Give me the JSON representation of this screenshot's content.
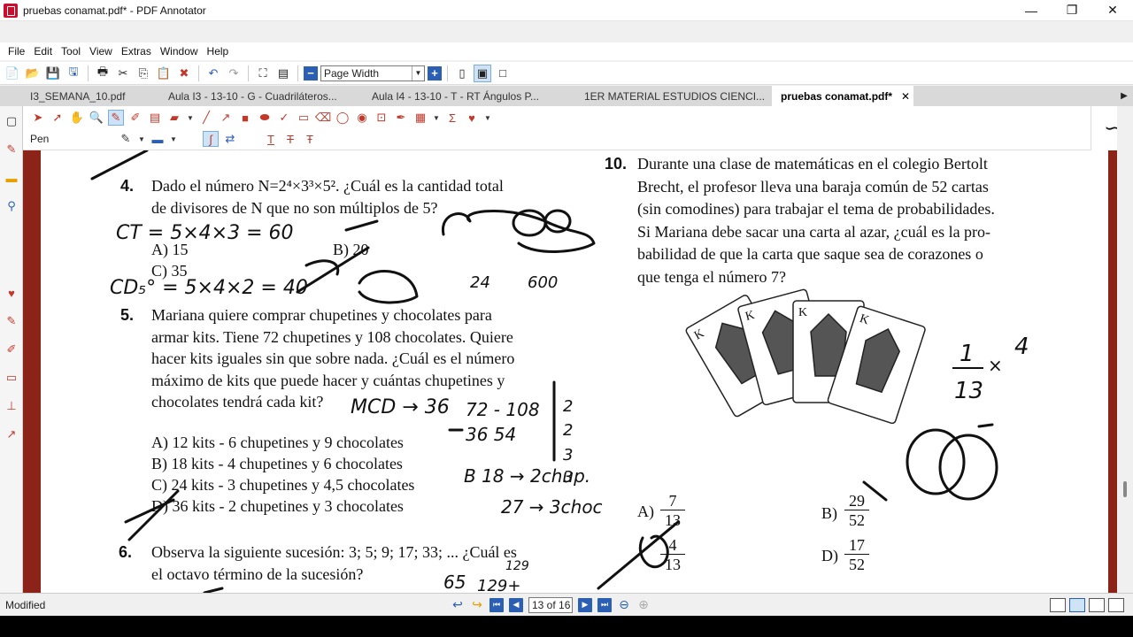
{
  "window": {
    "title": "pruebas conamat.pdf* - PDF Annotator",
    "controls": [
      "—",
      "❐",
      "✕"
    ]
  },
  "menu": [
    "File",
    "Edit",
    "Tool",
    "View",
    "Extras",
    "Window",
    "Help"
  ],
  "toolbar": {
    "zoom_value": "Page Width"
  },
  "tabs": [
    {
      "label": "I3_SEMANA_10.pdf",
      "active": false
    },
    {
      "label": "Aula I3 - 13-10 - G - Cuadriláteros...",
      "active": false
    },
    {
      "label": "Aula I4 - 13-10 - T - RT Ángulos P...",
      "active": false
    },
    {
      "label": "1ER MATERIAL ESTUDIOS CIENCI...",
      "active": false
    },
    {
      "label": "pruebas conamat.pdf*",
      "active": true,
      "close": "✕"
    }
  ],
  "annotation_toolbar": {
    "pen_label": "Pen"
  },
  "document": {
    "q4": {
      "number": "4.",
      "line1": "Dado el número N=2⁴×3³×5². ¿Cuál es la cantidad total",
      "line2": "de divisores de N que no son múltiplos de 5?",
      "options": [
        "A)  15",
        "B)  20",
        "C)  35"
      ]
    },
    "q5": {
      "number": "5.",
      "lines": [
        "Mariana quiere comprar chupetines y chocolates para",
        "armar kits. Tiene 72 chupetines y 108 chocolates. Quiere",
        "hacer kits iguales sin que sobre nada. ¿Cuál es el número",
        "máximo de kits que puede hacer y cuántas chupetines y",
        "chocolates tendrá cada kit?"
      ],
      "options": [
        "A)  12 kits - 6 chupetines y 9 chocolates",
        "B)  18 kits - 4 chupetines y 6 chocolates",
        "C)  24 kits - 3 chupetines y 4,5 chocolates",
        "D)  36 kits - 2 chupetines y 3 chocolates"
      ]
    },
    "q6": {
      "number": "6.",
      "line1": "Observa la siguiente sucesión: 3; 5; 9; 17; 33; ... ¿Cuál es",
      "line2": "el octavo término de la sucesión?"
    },
    "q10": {
      "number": "10.",
      "lines": [
        "Durante una clase de matemáticas en el colegio Bertolt",
        "Brecht, el profesor lleva una baraja común de 52 cartas",
        "(sin comodines) para trabajar el tema de probabilidades.",
        "Si Mariana debe sacar una carta al azar, ¿cuál es la pro-",
        "babilidad de que la carta que saque sea de corazones o",
        "que tenga el número 7?"
      ],
      "options": [
        {
          "label": "A)",
          "num": "7",
          "den": "13"
        },
        {
          "label": "B)",
          "num": "29",
          "den": "52"
        },
        {
          "label": "C)",
          "num": "4",
          "den": "13"
        },
        {
          "label": "D)",
          "num": "17",
          "den": "52"
        }
      ]
    },
    "handwriting": {
      "ct": "CT = 5×4×3 = 60",
      "cd": "CD₅° = 5×4×2 = 40",
      "mcd": "MCD → 36",
      "div_top": "72 - 108",
      "div_mid": "36    54",
      "factors": [
        "2",
        "2",
        "3",
        "3"
      ],
      "b_line": "B 18 → 2chup.",
      "choc": "27 → 3choc",
      "n24": "24",
      "n600": "600",
      "seq_a": "65",
      "seq_b": "129",
      "seq_c": "129+",
      "frac_num": "1",
      "frac_den": "13",
      "times": "×",
      "four": "4"
    }
  },
  "status": {
    "text": "Modified",
    "page_indicator": "13 of 16"
  },
  "colors": {
    "accent": "#2b5fb4",
    "annotation_red": "#c0392b",
    "page_border": "#8b2318"
  }
}
